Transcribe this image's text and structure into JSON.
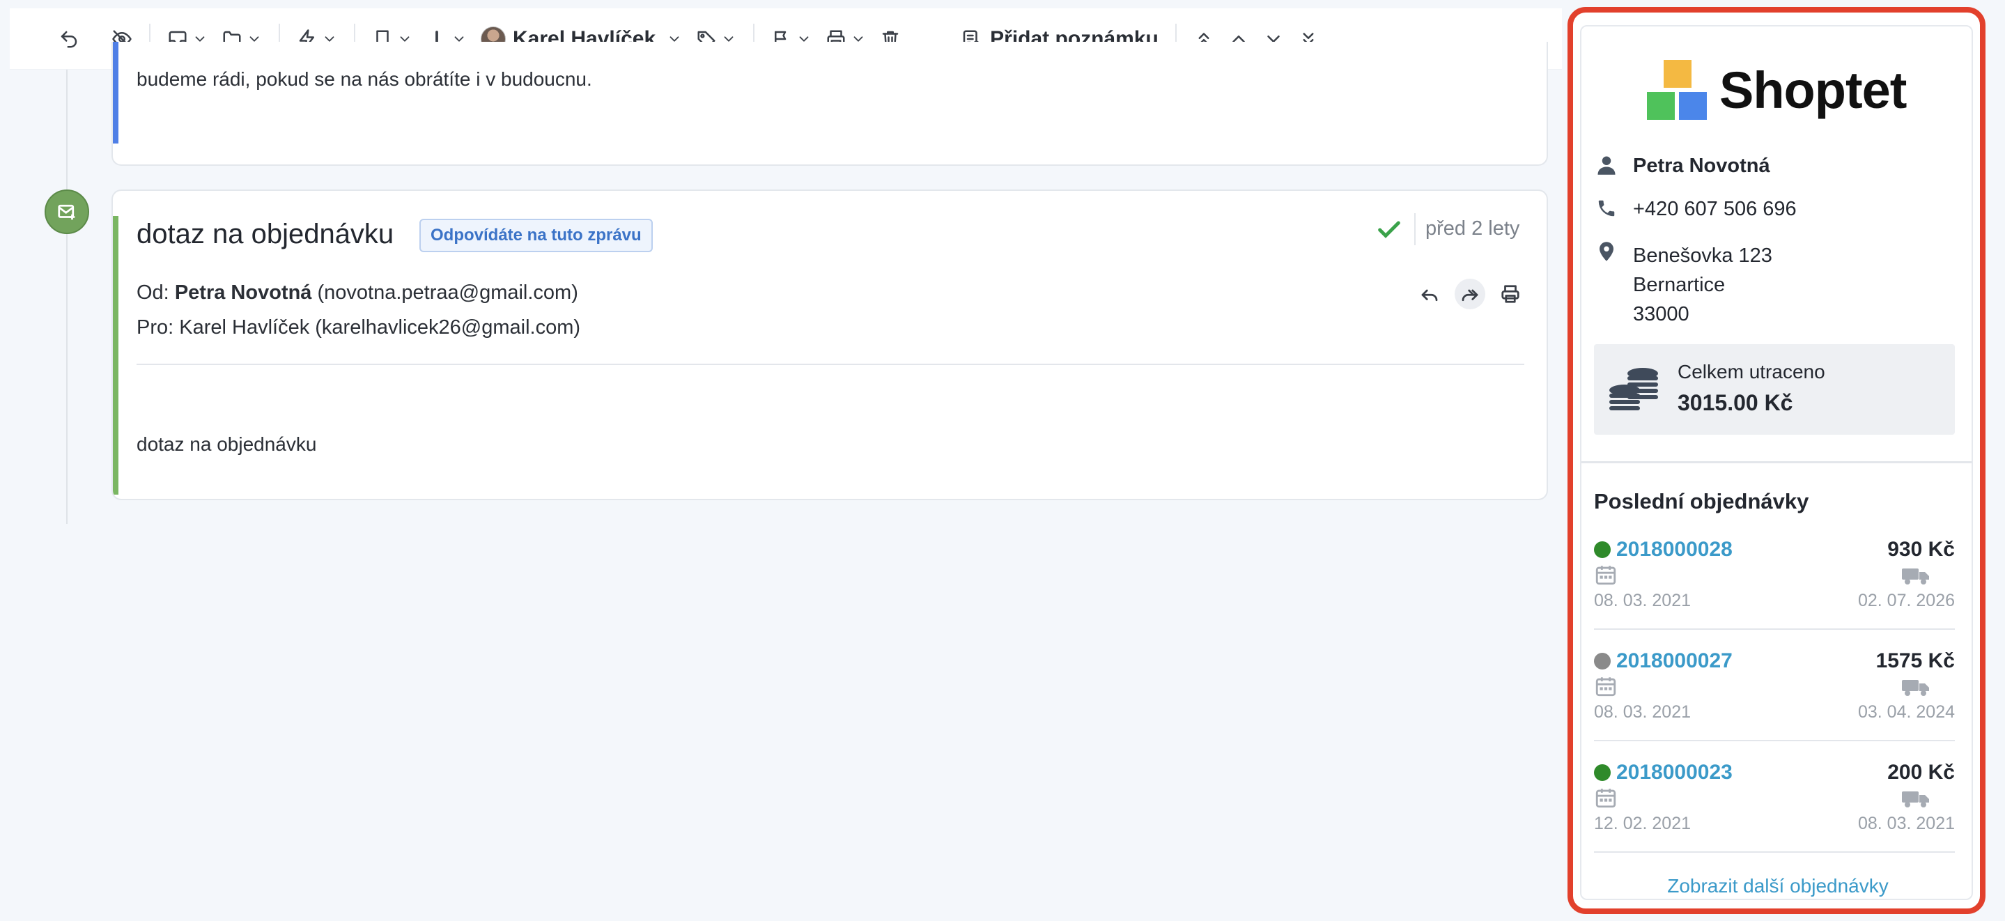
{
  "toolbar": {
    "user_name": "Karel Havlíček",
    "add_note_label": "Přidat poznámku"
  },
  "previous_message": {
    "text": "budeme rádi, pokud se na nás obrátíte i v budoucnu."
  },
  "message": {
    "subject": "dotaz na objednávku",
    "reply_badge": "Odpovídáte na tuto zprávu",
    "time": "před 2 lety",
    "from_prefix": "Od:",
    "from_name": "Petra Novotná",
    "from_email": "(novotna.petraa@gmail.com)",
    "to": "Pro: Karel Havlíček (karelhavlicek26@gmail.com)",
    "body": "dotaz na objednávku"
  },
  "panel": {
    "logo_text": "Shoptet",
    "customer_name": "Petra Novotná",
    "phone": "+420 607 506 696",
    "address": [
      "Benešovka 123",
      "Bernartice",
      "33000"
    ],
    "spent_label": "Celkem utraceno",
    "spent_value": "3015.00 Kč",
    "orders_title": "Poslední objednávky",
    "orders": [
      {
        "number": "2018000028",
        "price": "930 Kč",
        "created": "08. 03. 2021",
        "delivery": "02. 07. 2026",
        "status_color": "#2f8a2a"
      },
      {
        "number": "2018000027",
        "price": "1575 Kč",
        "created": "08. 03. 2021",
        "delivery": "03. 04. 2024",
        "status_color": "#8a8a8a"
      },
      {
        "number": "2018000023",
        "price": "200 Kč",
        "created": "12. 02. 2021",
        "delivery": "08. 03. 2021",
        "status_color": "#2f8a2a"
      }
    ],
    "show_more": "Zobrazit další objednávky"
  },
  "colors": {
    "accent_blue": "#4f7fe6",
    "accent_green": "#7ab662",
    "link": "#3b9ac9",
    "highlight_frame": "#e2402c"
  }
}
